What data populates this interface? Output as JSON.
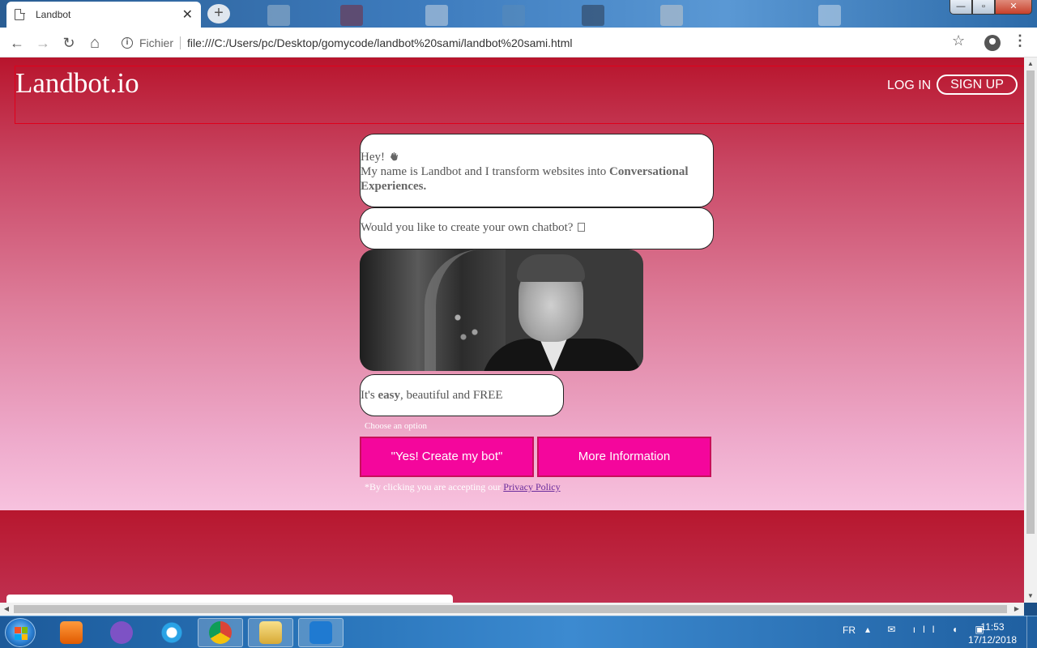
{
  "browser": {
    "tab_title": "Landbot",
    "tab_close": "✕",
    "new_tab": "+",
    "scheme_label": "Fichier",
    "url": "file:///C:/Users/pc/Desktop/gomycode/landbot%20sami/landbot%20sami.html",
    "nav": {
      "back": "←",
      "forward": "→",
      "reload": "↻",
      "home": "⌂"
    },
    "star": "☆",
    "menu": "⋮",
    "window_controls": {
      "minimize": "—",
      "maximize": "▫",
      "close": "✕"
    }
  },
  "page": {
    "logo": "Landbot.io",
    "login": "LOG IN",
    "signup": "SIGN UP",
    "messages": {
      "greeting": "Hey!",
      "intro_prefix": "My name is Landbot and I transform websites into",
      "intro_bold": "Conversational Experiences.",
      "question": "Would you like to create your own chatbot?",
      "tagline_prefix": "It's",
      "tagline_bold": "easy",
      "tagline_suffix": ", beautiful and FREE"
    },
    "choose_label": "Choose an option",
    "options": [
      "\"Yes! Create my bot\"",
      "More Information"
    ],
    "privacy_prefix": "*By clicking you are accepting our",
    "privacy_link": "Privacy Policy"
  },
  "scroll": {
    "up": "▲",
    "down": "▼",
    "left": "◀",
    "right": "▶"
  },
  "taskbar": {
    "lang": "FR",
    "tray": "▴ ✉ ıll ◖ ▣",
    "time": "11:53",
    "date": "17/12/2018",
    "apps": [
      "media-player",
      "viber",
      "internet-explorer",
      "chrome",
      "file-explorer",
      "visual-studio-code"
    ]
  },
  "colors": {
    "header_red": "#b8142c",
    "button_pink": "#f4069c",
    "link_purple": "#6a2d9c"
  }
}
